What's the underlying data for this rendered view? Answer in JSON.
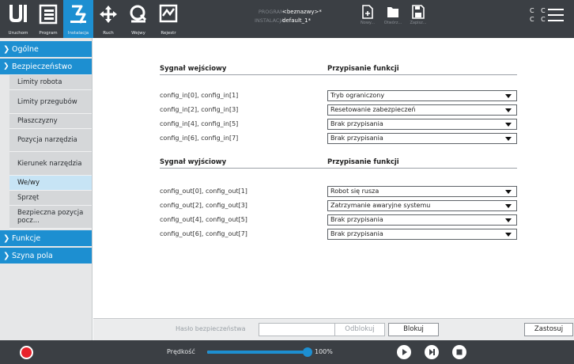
{
  "topbar": {
    "tabs": [
      {
        "label": "Uruchom",
        "icon": "run-icon"
      },
      {
        "label": "Program",
        "icon": "program-icon"
      },
      {
        "label": "Instalacja",
        "icon": "installation-icon"
      },
      {
        "label": "Ruch",
        "icon": "move-icon"
      },
      {
        "label": "Wejwy",
        "icon": "io-icon"
      },
      {
        "label": "Rejestr",
        "icon": "log-icon"
      }
    ],
    "program_caption": "PROGRAM",
    "installation_caption": "INSTALACJA",
    "program_name": "<beznazwy>*",
    "installation_name": "default_1*",
    "file_buttons": [
      {
        "label": "Nowy...",
        "icon": "new-file-icon"
      },
      {
        "label": "Otwórz...",
        "icon": "open-folder-icon"
      },
      {
        "label": "Zapisz...",
        "icon": "save-icon"
      }
    ],
    "cc_text": "C C",
    "accent": "#1d8fd1"
  },
  "sidebar": {
    "groups": [
      {
        "label": "Ogólne"
      },
      {
        "label": "Bezpieczeństwo"
      },
      {
        "label": "Funkcje"
      },
      {
        "label": "Szyna pola"
      }
    ],
    "safety_items": [
      {
        "label": "Limity robota"
      },
      {
        "label": "Limity przegubów"
      },
      {
        "label": "Płaszczyzny"
      },
      {
        "label": "Pozycja narzędzia"
      },
      {
        "label": "Kierunek narzędzia"
      },
      {
        "label": "We/wy"
      },
      {
        "label": "Sprzęt"
      },
      {
        "label": "Bezpieczna pozycja pocz..."
      }
    ]
  },
  "main": {
    "input_header": "Sygnał wejściowy",
    "input_func_header": "Przypisanie funkcji",
    "inputs": [
      {
        "signal": "config_in[0], config_in[1]",
        "function": "Tryb ograniczony"
      },
      {
        "signal": "config_in[2], config_in[3]",
        "function": "Resetowanie zabezpieczeń"
      },
      {
        "signal": "config_in[4], config_in[5]",
        "function": "Brak przypisania"
      },
      {
        "signal": "config_in[6], config_in[7]",
        "function": "Brak przypisania"
      }
    ],
    "output_header": "Sygnał wyjściowy",
    "output_func_header": "Przypisanie funkcji",
    "outputs": [
      {
        "signal": "config_out[0], config_out[1]",
        "function": "Robot się rusza"
      },
      {
        "signal": "config_out[2], config_out[3]",
        "function": "Zatrzymanie awaryjne systemu"
      },
      {
        "signal": "config_out[4], config_out[5]",
        "function": "Brak przypisania"
      },
      {
        "signal": "config_out[6], config_out[7]",
        "function": "Brak przypisania"
      }
    ]
  },
  "password_bar": {
    "label": "Hasło bezpieczeństwa",
    "value": "",
    "unlock_label": "Odblokuj",
    "lock_label": "Blokuj",
    "apply_label": "Zastosuj"
  },
  "footer": {
    "speed_label": "Prędkość",
    "speed_value": "100%",
    "speed_fraction": 1.0
  }
}
